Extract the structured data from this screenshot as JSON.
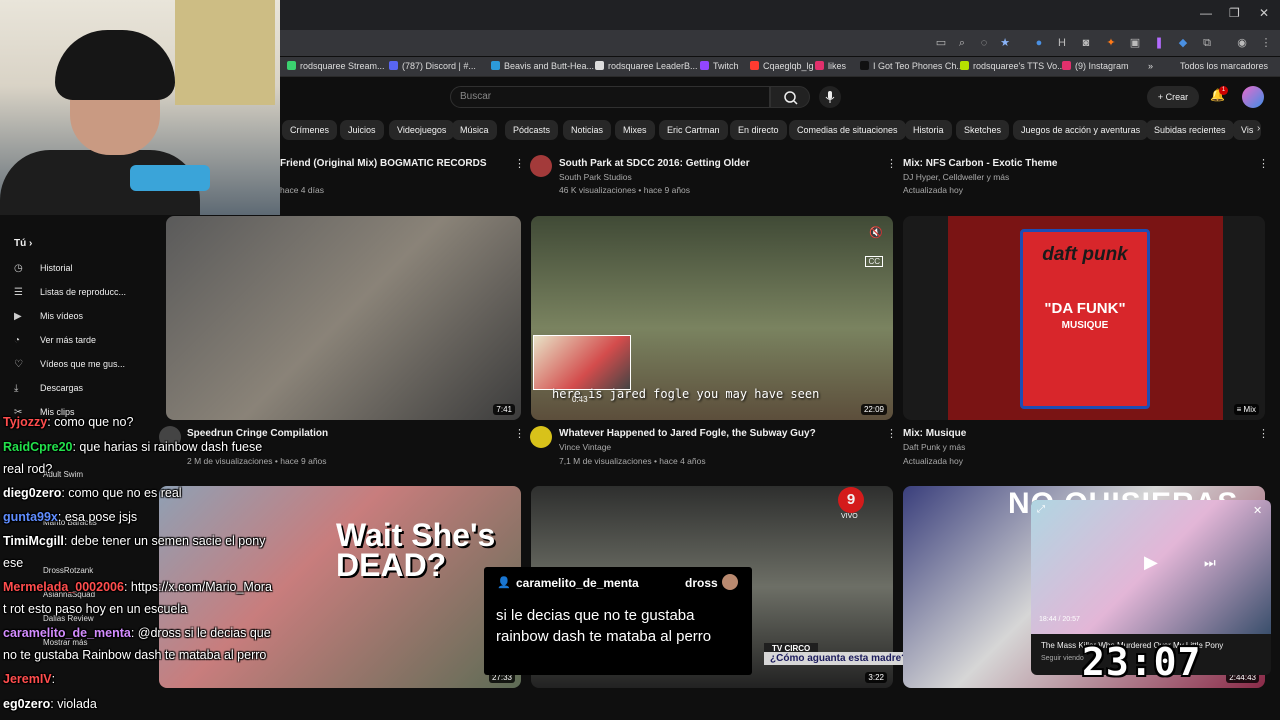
{
  "window": {
    "minimize": "—",
    "restore": "❐",
    "close": "✕"
  },
  "bookmarks": [
    {
      "label": "rodsquaree Stream...",
      "color": "#3bd16f"
    },
    {
      "label": "(787) Discord | #...",
      "color": "#5865f2"
    },
    {
      "label": "Beavis and Butt-Hea...",
      "color": "#2c9ad9"
    },
    {
      "label": "rodsquaree LeaderB...",
      "color": "#dddddd"
    },
    {
      "label": "Twitch",
      "color": "#9146ff"
    },
    {
      "label": "Cqaeglqb_lg",
      "color": "#ff3b30"
    },
    {
      "label": "likes",
      "color": "#e1306c"
    },
    {
      "label": "I Got Teo Phones Ch...",
      "color": "#111111"
    },
    {
      "label": "rodsquaree's TTS Vo...",
      "color": "#b6e000"
    },
    {
      "label": "(9) Instagram",
      "color": "#e1306c"
    },
    {
      "label": "»",
      "color": ""
    },
    {
      "label": "Todos los marcadores",
      "color": ""
    }
  ],
  "header": {
    "search_placeholder": "Buscar",
    "create_label": "Crear",
    "notif_count": "1"
  },
  "chips": [
    "Crímenes",
    "Juicios",
    "Videojuegos",
    "Música",
    "Pódcasts",
    "Noticias",
    "Mixes",
    "Eric Cartman",
    "En directo",
    "Comedias de situaciones",
    "Historia",
    "Sketches",
    "Juegos de acción y aventuras",
    "Subidas recientes",
    "Vis"
  ],
  "sidebar": {
    "heading": "Tú",
    "items": [
      {
        "icon": "◷",
        "label": "Historial"
      },
      {
        "icon": "☰",
        "label": "Listas de reproducc..."
      },
      {
        "icon": "▶",
        "label": "Mis vídeos"
      },
      {
        "icon": "◔",
        "label": "Ver más tarde"
      },
      {
        "icon": "♡",
        "label": "Vídeos que me gus..."
      },
      {
        "icon": "⤓",
        "label": "Descargas"
      },
      {
        "icon": "✂",
        "label": "Mis clips"
      }
    ],
    "subs": [
      "Adult Swim",
      "Marito Baracus",
      "DrossRotzank",
      "AsiannaSquad",
      "Dallas Review",
      "Mostrar más"
    ]
  },
  "videos": {
    "top_row": [
      {
        "title": "Friend (Original Mix) BOGMATIC RECORDS",
        "meta": "hace 4 días"
      },
      {
        "title": "South Park at SDCC 2016: Getting Older",
        "channel": "South Park Studios",
        "meta": "46 K visualizaciones • hace 9 años"
      },
      {
        "title": "Mix: NFS Carbon - Exotic Theme",
        "channel": "DJ Hyper, Celldweller y más",
        "meta": "Actualizada hoy"
      }
    ],
    "row2": [
      {
        "title": "Speedrun Cringe Compilation",
        "channel": "",
        "meta": "2 M de visualizaciones • hace 9 años",
        "duration": "7:41"
      },
      {
        "title": "Whatever Happened to Jared Fogle, the Subway Guy?",
        "channel": "Vince Vintage",
        "meta": "7,1 M de visualizaciones • hace 4 años",
        "duration": "22:09",
        "subtitle": "here is jared fogle you may have seen",
        "mini_time": "0:43"
      },
      {
        "title": "Mix: Musique",
        "channel": "Daft Punk y más",
        "meta": "Actualizada hoy",
        "badge": "Mix"
      }
    ],
    "row3": [
      {
        "overlay": "Wait She's DEAD?",
        "duration": "27:33"
      },
      {
        "channel_logo": "9",
        "live": "VIVO",
        "banner_top": "TV CIRCO",
        "banner": "¿Cómo aguanta esta madre?",
        "duration": "3:22"
      },
      {
        "overlay": "NO QUISIERAS",
        "duration": "2:44:43"
      }
    ],
    "daft": {
      "logo": "daft punk",
      "title": "\"DA FUNK\"",
      "sub": "MUSIQUE"
    }
  },
  "miniplayer": {
    "title": "The Mass Killer Who Murdered Over My Little Pony",
    "channel": "Seguir viendo",
    "time": "18:44 / 20:57"
  },
  "clock": "23:07",
  "chat": [
    {
      "user": "Tyjozzy",
      "color": "#ff4d4d",
      "text": ": como que no?"
    },
    {
      "user": "RaidCpre20",
      "color": "#22e04b",
      "text": ": que harias si rainbow dash fuese"
    },
    {
      "user": "",
      "color": "#ffffff",
      "text": "real rod?"
    },
    {
      "user": "dieg0zero",
      "color": "#ffffff",
      "text": ": como que no es real"
    },
    {
      "user": "gunta99x",
      "color": "#5f8dff",
      "text": ": esa pose jsjs"
    },
    {
      "user": "TimiMcgill",
      "color": "#ffffff",
      "text": ": debe tener un semen sacie el pony"
    },
    {
      "user": "",
      "color": "#ffffff",
      "text": "ese"
    },
    {
      "user": "Mermelada_0002006",
      "color": "#ff4d4d",
      "text": ": https://x.com/Mario_Mora"
    },
    {
      "user": "",
      "color": "#ffffff",
      "text": "t rot esto paso hoy en un escuela"
    },
    {
      "user": "caramelito_de_menta",
      "color": "#d38cff",
      "text": ": @dross si le decias que"
    },
    {
      "user": "",
      "color": "#ffffff",
      "text": "no te gustaba Rainbow dash te mataba al perro"
    },
    {
      "user": "JeremIV",
      "color": "#ff4d4d",
      "text": ":"
    },
    {
      "user": "eg0zero",
      "color": "#ffffff",
      "text": ": violada"
    }
  ],
  "highlight": {
    "user": "caramelito_de_menta",
    "streamer": "dross",
    "message": "si le decias que no te gustaba rainbow dash te mataba al perro"
  }
}
